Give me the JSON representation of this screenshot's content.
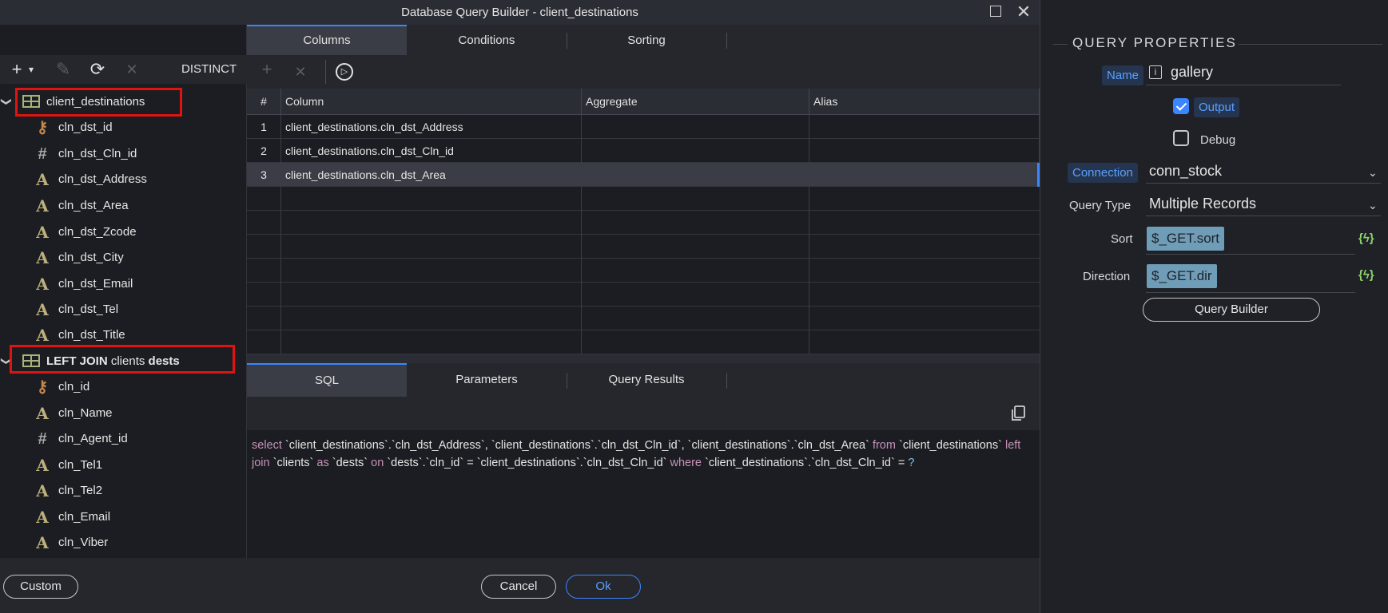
{
  "window": {
    "title": "Database Query Builder - client_destinations"
  },
  "top_tabs": [
    {
      "label": "Columns",
      "active": true
    },
    {
      "label": "Conditions",
      "active": false
    },
    {
      "label": "Sorting",
      "active": false
    }
  ],
  "left_toolbar": {
    "add": "+",
    "add_dropdown": "▾",
    "edit": "✎",
    "refresh": "⟳",
    "remove": "✕",
    "distinct_label": "DISTINCT"
  },
  "col_toolbar": {
    "add": "+",
    "remove": "✕",
    "run": "▷"
  },
  "tree": {
    "main_table": {
      "name": "client_destinations",
      "fields": [
        {
          "name": "cln_dst_id",
          "icon": "key-icon"
        },
        {
          "name": "cln_dst_Cln_id",
          "icon": "number-icon"
        },
        {
          "name": "cln_dst_Address",
          "icon": "text-icon"
        },
        {
          "name": "cln_dst_Area",
          "icon": "text-icon"
        },
        {
          "name": "cln_dst_Zcode",
          "icon": "text-icon"
        },
        {
          "name": "cln_dst_City",
          "icon": "text-icon"
        },
        {
          "name": "cln_dst_Email",
          "icon": "text-icon"
        },
        {
          "name": "cln_dst_Tel",
          "icon": "text-icon"
        },
        {
          "name": "cln_dst_Title",
          "icon": "text-icon"
        }
      ]
    },
    "join_table": {
      "join_label": "LEFT JOIN",
      "table": "clients",
      "alias": "dests",
      "fields": [
        {
          "name": "cln_id",
          "icon": "key-icon"
        },
        {
          "name": "cln_Name",
          "icon": "text-icon"
        },
        {
          "name": "cln_Agent_id",
          "icon": "number-icon"
        },
        {
          "name": "cln_Tel1",
          "icon": "text-icon"
        },
        {
          "name": "cln_Tel2",
          "icon": "text-icon"
        },
        {
          "name": "cln_Email",
          "icon": "text-icon"
        },
        {
          "name": "cln_Viber",
          "icon": "text-icon"
        }
      ]
    }
  },
  "grid": {
    "headers": [
      "#",
      "Column",
      "Aggregate",
      "Alias"
    ],
    "rows": [
      {
        "num": "1",
        "column": "client_destinations.cln_dst_Address",
        "aggregate": "",
        "alias": ""
      },
      {
        "num": "2",
        "column": "client_destinations.cln_dst_Cln_id",
        "aggregate": "",
        "alias": ""
      },
      {
        "num": "3",
        "column": "client_destinations.cln_dst_Area",
        "aggregate": "",
        "alias": ""
      }
    ]
  },
  "bottom_tabs": [
    {
      "label": "SQL",
      "active": true
    },
    {
      "label": "Parameters",
      "active": false
    },
    {
      "label": "Query Results",
      "active": false
    }
  ],
  "sql": {
    "kw_select": "select",
    "cols": "`client_destinations`.`cln_dst_Address`, `client_destinations`.`cln_dst_Cln_id`, `client_destinations`.`cln_dst_Area`",
    "kw_from": "from",
    "table": "`client_destinations`",
    "kw_left_join": "left join",
    "join_table": "`clients`",
    "kw_as": "as",
    "alias": "`dests`",
    "kw_on": "on",
    "cond": "`dests`.`cln_id` = `client_destinations`.`cln_dst_Cln_id`",
    "kw_where": "where",
    "where_cond": "`client_destinations`.`cln_dst_Cln_id` =",
    "param": "?"
  },
  "buttons": {
    "custom": "Custom",
    "cancel": "Cancel",
    "ok": "Ok"
  },
  "properties": {
    "section_title": "QUERY PROPERTIES",
    "name_label": "Name",
    "name_value": "gallery",
    "output_label": "Output",
    "output_checked": true,
    "debug_label": "Debug",
    "debug_checked": false,
    "connection_label": "Connection",
    "connection_value": "conn_stock",
    "query_type_label": "Query Type",
    "query_type_value": "Multiple Records",
    "sort_label": "Sort",
    "sort_value": "$_GET.sort",
    "direction_label": "Direction",
    "direction_value": "$_GET.dir",
    "dynamic_icon": "{ϟ}",
    "query_builder_button": "Query Builder"
  }
}
